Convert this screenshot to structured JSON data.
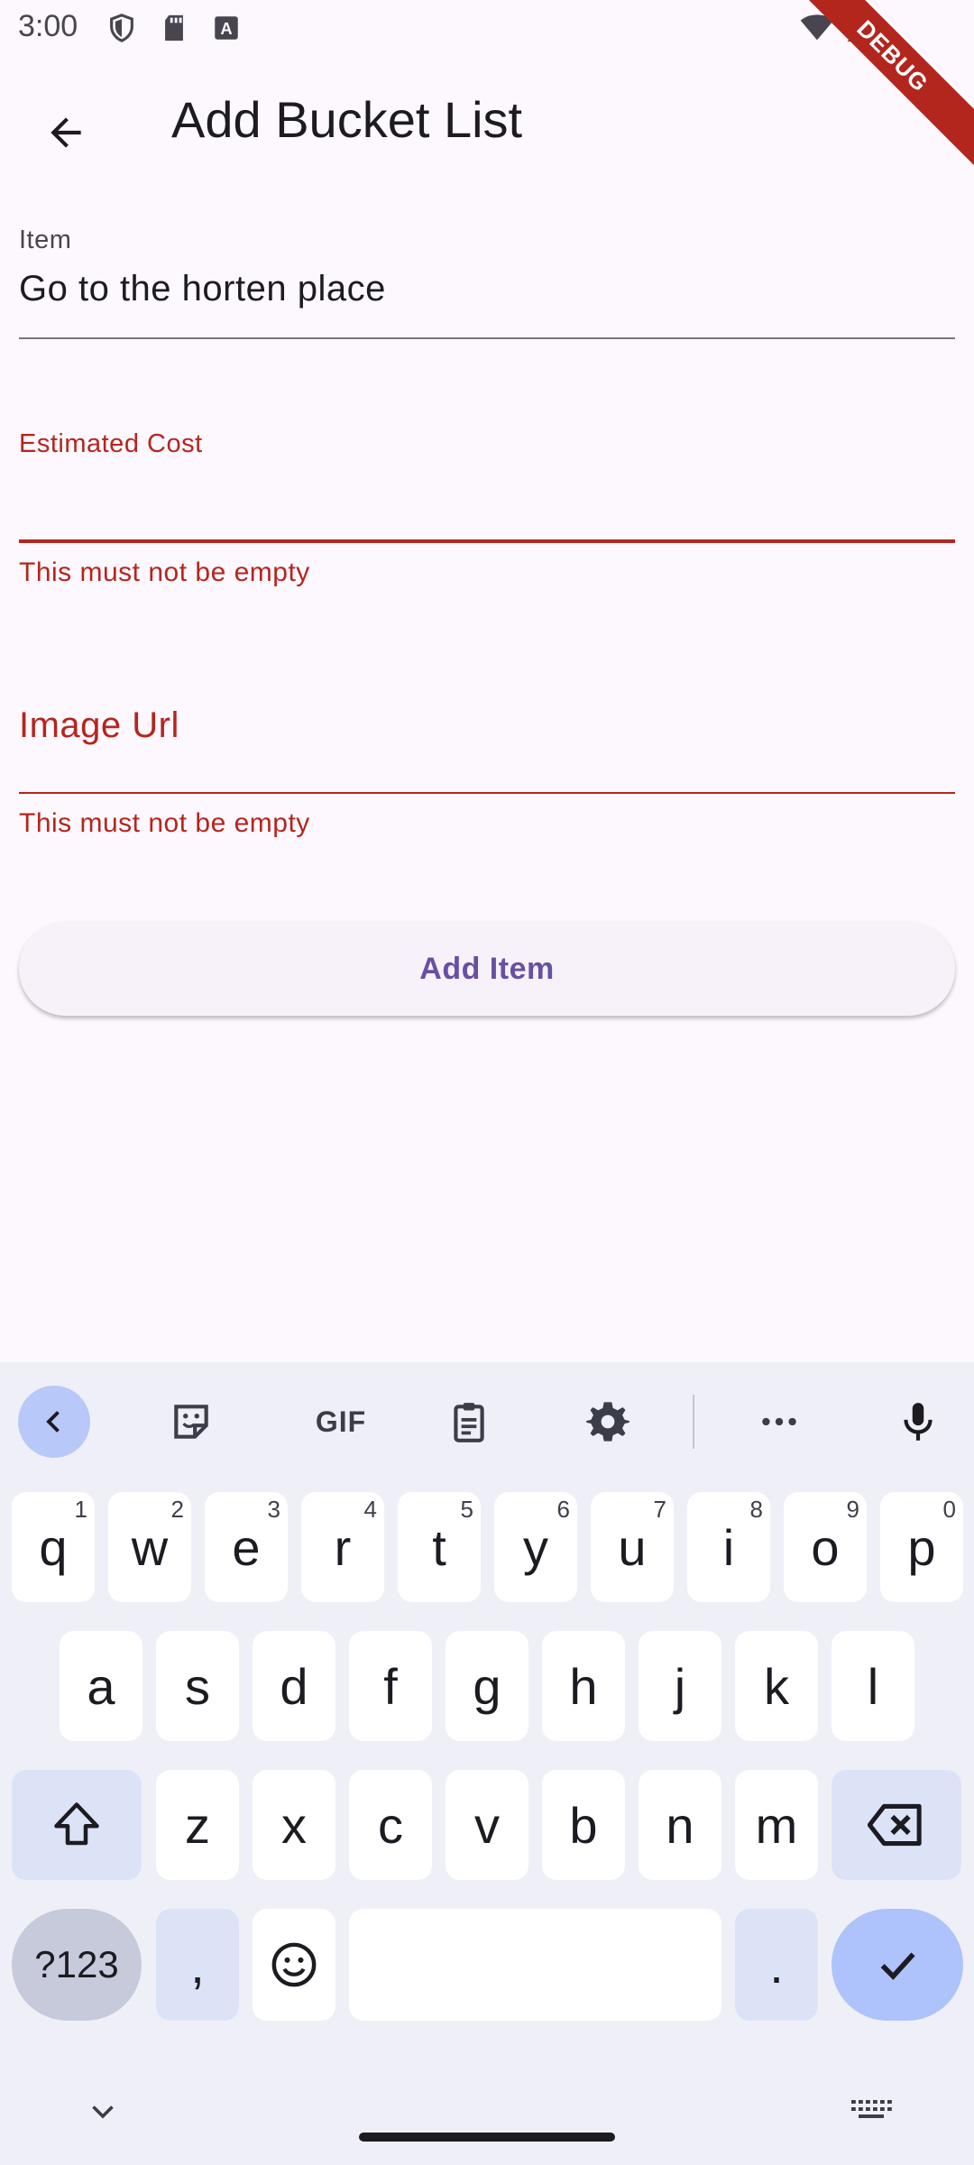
{
  "status_bar": {
    "time": "3:00",
    "icons_left": [
      "shield-icon",
      "sd-card-icon",
      "keyboard-a-icon"
    ],
    "icons_right": [
      "wifi-icon",
      "signal-icon"
    ],
    "debug_label": "DEBUG"
  },
  "app_bar": {
    "title": "Add Bucket List",
    "back_icon": "arrow-back-icon"
  },
  "form": {
    "item": {
      "label": "Item",
      "value": "Go to the horten place"
    },
    "estimated_cost": {
      "label": "Estimated Cost",
      "value": "",
      "error": "This must not be empty"
    },
    "image_url": {
      "label": "Image Url",
      "value": "",
      "error": "This must not be empty"
    },
    "submit_label": "Add Item"
  },
  "colors": {
    "error": "#b3261e",
    "primary": "#6750a4",
    "background": "#fdf7fe"
  },
  "keyboard": {
    "toolbar": [
      "chevron-left-icon",
      "sticker-icon",
      "GIF",
      "clipboard-icon",
      "gear-icon",
      "more-icon",
      "mic-icon"
    ],
    "row1": [
      {
        "key": "q",
        "hint": "1"
      },
      {
        "key": "w",
        "hint": "2"
      },
      {
        "key": "e",
        "hint": "3"
      },
      {
        "key": "r",
        "hint": "4"
      },
      {
        "key": "t",
        "hint": "5"
      },
      {
        "key": "y",
        "hint": "6"
      },
      {
        "key": "u",
        "hint": "7"
      },
      {
        "key": "i",
        "hint": "8"
      },
      {
        "key": "o",
        "hint": "9"
      },
      {
        "key": "p",
        "hint": "0"
      }
    ],
    "row2": [
      "a",
      "s",
      "d",
      "f",
      "g",
      "h",
      "j",
      "k",
      "l"
    ],
    "row3": [
      "z",
      "x",
      "c",
      "v",
      "b",
      "n",
      "m"
    ],
    "symbols_label": "?123",
    "comma": ",",
    "period": ".",
    "emoji_icon": "emoji-icon",
    "shift_icon": "shift-icon",
    "backspace_icon": "backspace-icon",
    "enter_icon": "check-icon"
  }
}
